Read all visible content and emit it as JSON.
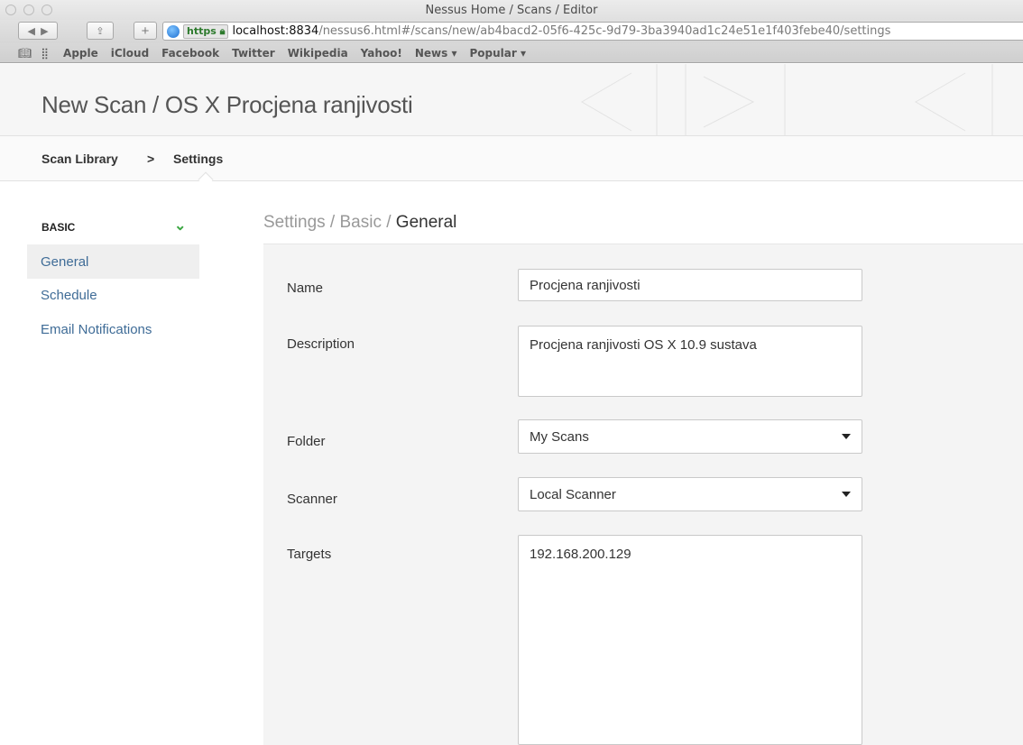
{
  "browser": {
    "window_title": "Nessus Home / Scans / Editor",
    "https_label": "https",
    "url_host": "localhost:8834",
    "url_path": "/nessus6.html#/scans/new/ab4bacd2-05f6-425c-9d79-3ba3940ad1c24e51e1f403febe40/settings",
    "bookmarks": [
      "Apple",
      "iCloud",
      "Facebook",
      "Twitter",
      "Wikipedia",
      "Yahoo!",
      "News ▾",
      "Popular ▾"
    ]
  },
  "header": {
    "title": "New Scan / OS X Procjena ranjivosti"
  },
  "breadcrumb": {
    "items": [
      "Scan Library",
      "Settings"
    ],
    "separator": ">"
  },
  "sidebar": {
    "section_label": "BASIC",
    "items": [
      {
        "label": "General",
        "active": true
      },
      {
        "label": "Schedule",
        "active": false
      },
      {
        "label": "Email Notifications",
        "active": false
      }
    ]
  },
  "content": {
    "crumb_prefix": "Settings / Basic / ",
    "crumb_current": "General",
    "form": {
      "name_label": "Name",
      "name_value": "Procjena ranjivosti",
      "description_label": "Description",
      "description_value": "Procjena ranjivosti OS X 10.9 sustava",
      "folder_label": "Folder",
      "folder_value": "My Scans",
      "scanner_label": "Scanner",
      "scanner_value": "Local Scanner",
      "targets_label": "Targets",
      "targets_value": "192.168.200.129"
    }
  },
  "colors": {
    "link": "#3f6c97",
    "accent_green": "#3aa641",
    "panel_bg": "#f4f4f4"
  }
}
